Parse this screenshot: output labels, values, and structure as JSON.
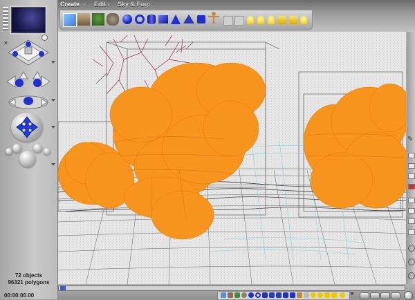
{
  "menu": {
    "create": "Create",
    "edit": "Edit",
    "sky_fog": "Sky & Fog"
  },
  "status": {
    "objects": "72 objects",
    "polygons": "96321 polygons",
    "timecode": "00:00:00.00"
  },
  "colors": {
    "tree_orange": "#f7941d",
    "wire_gray": "#606060",
    "wire_cyan": "#7fd6d6",
    "tree_branch": "#8b2e4a",
    "blue_control": "#1f2fd0"
  },
  "toolbar_icons": [
    "water-icon",
    "terrain-icon",
    "plant-icon",
    "rock-icon",
    "cube-icon",
    "sphere-icon",
    "cylinder-icon",
    "cone-icon",
    "pyramid-icon",
    "torus-icon",
    "figure-icon",
    "light-icon",
    "camera-icon"
  ]
}
